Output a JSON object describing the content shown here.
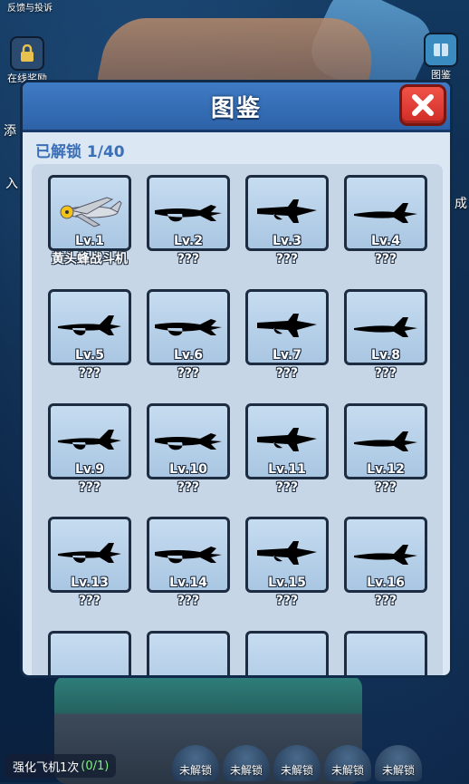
{
  "hud": {
    "feedback_label": "反馈与投诉",
    "online_reward_label": "在线奖励",
    "collection_label": "图鉴",
    "left_edge_1": "添",
    "left_edge_2": "入",
    "right_edge_1": "成"
  },
  "bottom": {
    "task_text": "强化飞机1次",
    "task_progress": "(0/1)",
    "locked_slots": [
      "未解锁",
      "未解锁",
      "未解锁",
      "未解锁",
      "未解锁"
    ]
  },
  "dialog": {
    "title": "图鉴",
    "unlock_count": "已解锁 1/40"
  },
  "cards": [
    {
      "level": "Lv.1",
      "name": "黄头蜂战斗机",
      "unlocked": true
    },
    {
      "level": "Lv.2",
      "name": "???",
      "unlocked": false
    },
    {
      "level": "Lv.3",
      "name": "???",
      "unlocked": false
    },
    {
      "level": "Lv.4",
      "name": "???",
      "unlocked": false
    },
    {
      "level": "Lv.5",
      "name": "???",
      "unlocked": false
    },
    {
      "level": "Lv.6",
      "name": "???",
      "unlocked": false
    },
    {
      "level": "Lv.7",
      "name": "???",
      "unlocked": false
    },
    {
      "level": "Lv.8",
      "name": "???",
      "unlocked": false
    },
    {
      "level": "Lv.9",
      "name": "???",
      "unlocked": false
    },
    {
      "level": "Lv.10",
      "name": "???",
      "unlocked": false
    },
    {
      "level": "Lv.11",
      "name": "???",
      "unlocked": false
    },
    {
      "level": "Lv.12",
      "name": "???",
      "unlocked": false
    },
    {
      "level": "Lv.13",
      "name": "???",
      "unlocked": false
    },
    {
      "level": "Lv.14",
      "name": "???",
      "unlocked": false
    },
    {
      "level": "Lv.15",
      "name": "???",
      "unlocked": false
    },
    {
      "level": "Lv.16",
      "name": "???",
      "unlocked": false
    },
    {
      "level": "",
      "name": "",
      "unlocked": false
    },
    {
      "level": "",
      "name": "",
      "unlocked": false
    },
    {
      "level": "",
      "name": "",
      "unlocked": false
    },
    {
      "level": "",
      "name": "",
      "unlocked": false
    }
  ],
  "colors": {
    "header_blue": "#2d62a8",
    "close_red": "#d02c26",
    "card_bg": "#a9c6e2",
    "silhouette": "#000000",
    "count_text": "#3b6fb8",
    "progress_green": "#7ef07e"
  }
}
